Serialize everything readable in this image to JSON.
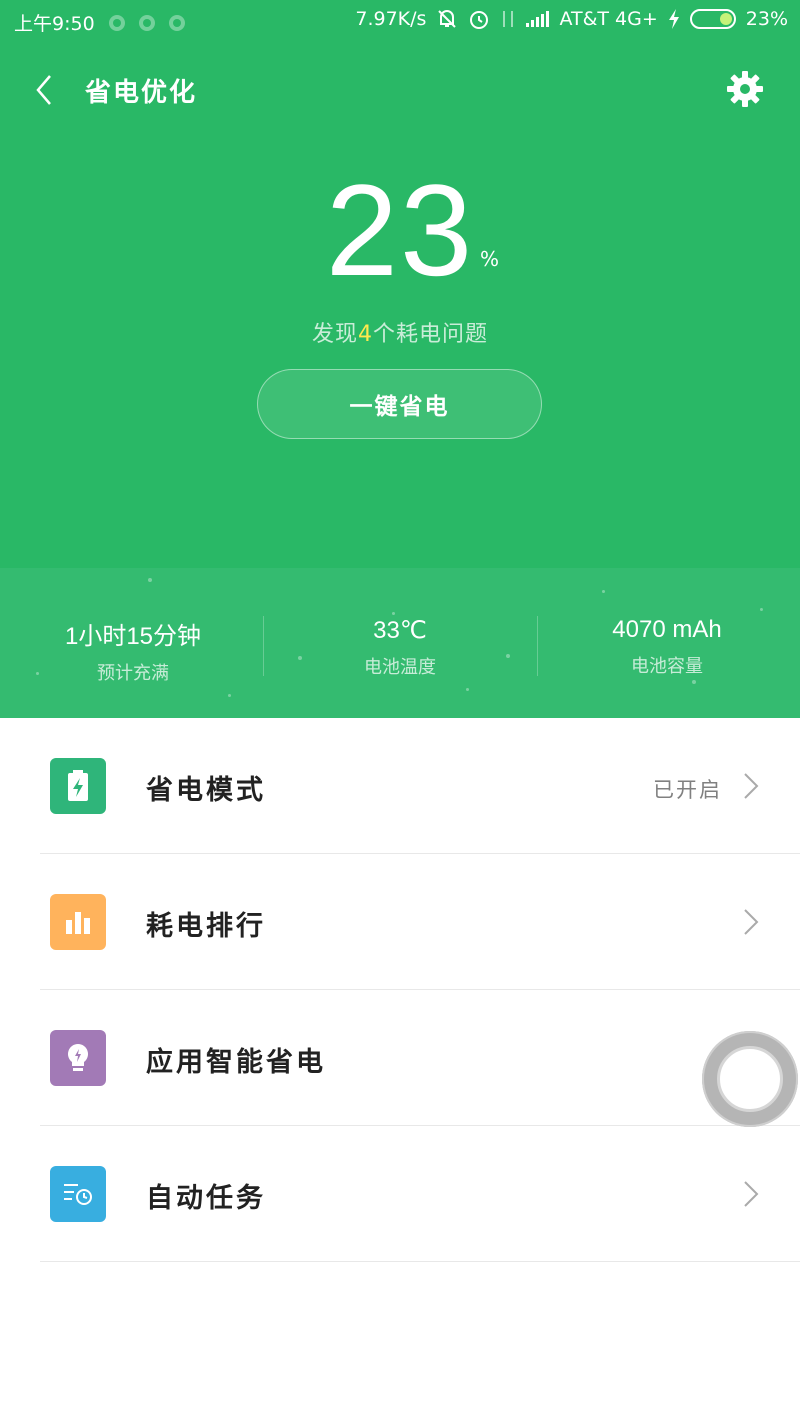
{
  "status_bar": {
    "time": "上午9:50",
    "net_speed": "7.97K/s",
    "carrier": "AT&T 4G+",
    "battery_text": "23%",
    "icons": [
      "infinity-icon",
      "nfc-icon",
      "infinity-icon",
      "bell-off-icon",
      "alarm-icon",
      "data-arrows-icon",
      "signal-icon",
      "charging-icon",
      "battery-icon"
    ]
  },
  "nav": {
    "title": "省电优化",
    "back_icon": "back-chevron-icon",
    "settings_icon": "gear-icon"
  },
  "battery": {
    "percent": "23",
    "percent_unit": "%",
    "issues_prefix": "发现",
    "issues_count": "4",
    "issues_suffix": "个耗电问题",
    "button_label": "一键省电"
  },
  "stats": [
    {
      "value": "1小时15分钟",
      "label": "预计充满"
    },
    {
      "value": "33℃",
      "label": "电池温度"
    },
    {
      "value": "4070 mAh",
      "label": "电池容量"
    }
  ],
  "menu": [
    {
      "label": "省电模式",
      "status": "已开启",
      "icon": "battery-bolt-icon",
      "color": "#2fb57a"
    },
    {
      "label": "耗电排行",
      "status": "",
      "icon": "bar-chart-icon",
      "color": "#ffb35c"
    },
    {
      "label": "应用智能省电",
      "status": "",
      "icon": "lightbulb-icon",
      "color": "#a27ab6"
    },
    {
      "label": "自动任务",
      "status": "",
      "icon": "task-clock-icon",
      "color": "#38aee0"
    }
  ],
  "colors": {
    "header_green": "#29b866",
    "stats_green": "#34bb70",
    "highlight_yellow": "#ffe94d"
  }
}
